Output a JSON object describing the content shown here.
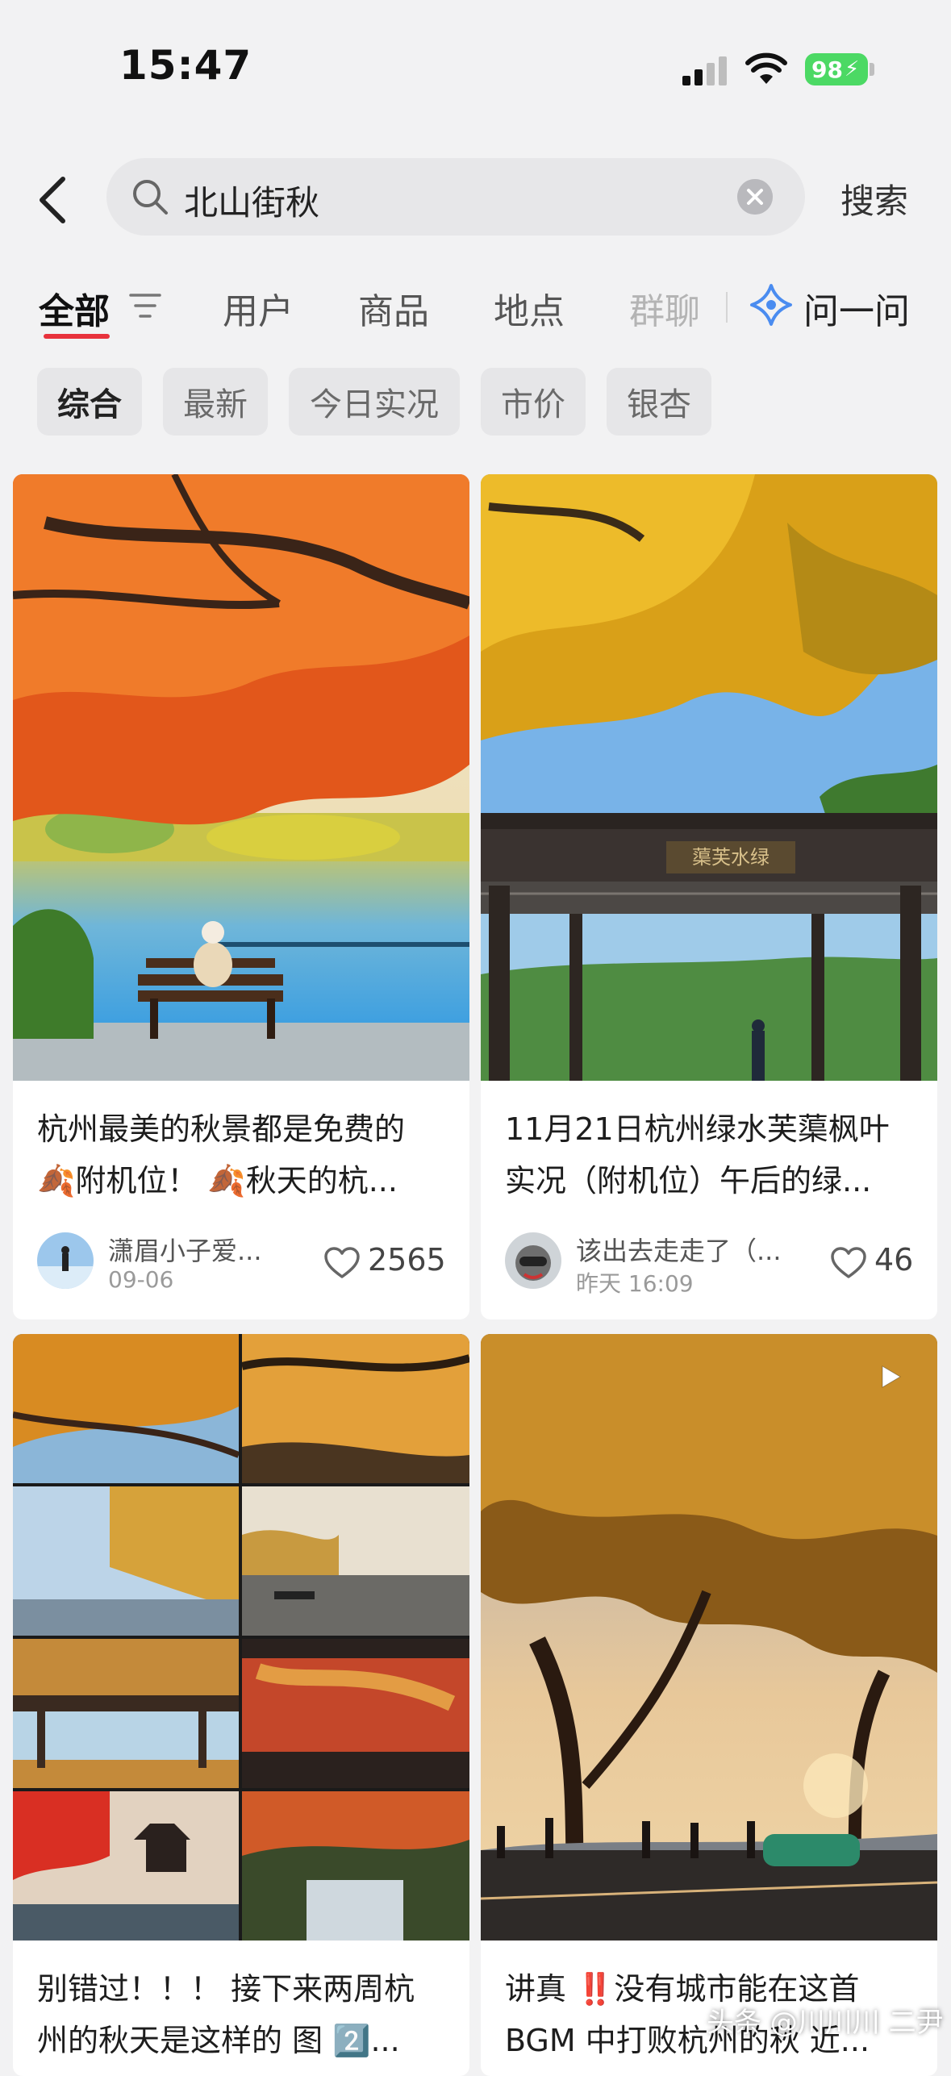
{
  "status_bar": {
    "time": "15:47",
    "battery": "98"
  },
  "search": {
    "query": "北山街秋",
    "submit_label": "搜索"
  },
  "tabs": {
    "all": "全部",
    "users": "用户",
    "goods": "商品",
    "places": "地点",
    "groups": "群聊",
    "ask": "问一问"
  },
  "chips": [
    "综合",
    "最新",
    "今日实况",
    "市价",
    "银杏"
  ],
  "cards": [
    {
      "title_line1": "杭州最美的秋景都是免费的",
      "title_line2": "🍂附机位！ 🍂秋天的杭...",
      "author": "潇眉小子爱...",
      "date": "09-06",
      "likes": "2565"
    },
    {
      "title_line1": "11月21日杭州绿水芙蕖枫叶",
      "title_line2": "实况（附机位）午后的绿...",
      "author": "该出去走走了（...",
      "date": "昨天 16:09",
      "likes": "46"
    },
    {
      "title_line1": "别错过！！！ 接下来两周杭",
      "title_line2": "州的秋天是这样的 图 2️⃣..."
    },
    {
      "title_line1": "讲真 ‼️没有城市能在这首",
      "title_line2": "BGM 中打败杭州的秋 近..."
    }
  ],
  "image_text": {
    "pavilion_plaque": "蕖芙水绿"
  },
  "watermark": "头条 @川川川 二尹",
  "colors": {
    "accent": "#e8323c",
    "background": "#f2f2f3",
    "ask_icon": "#4a8cf0",
    "battery": "#4cd964"
  }
}
